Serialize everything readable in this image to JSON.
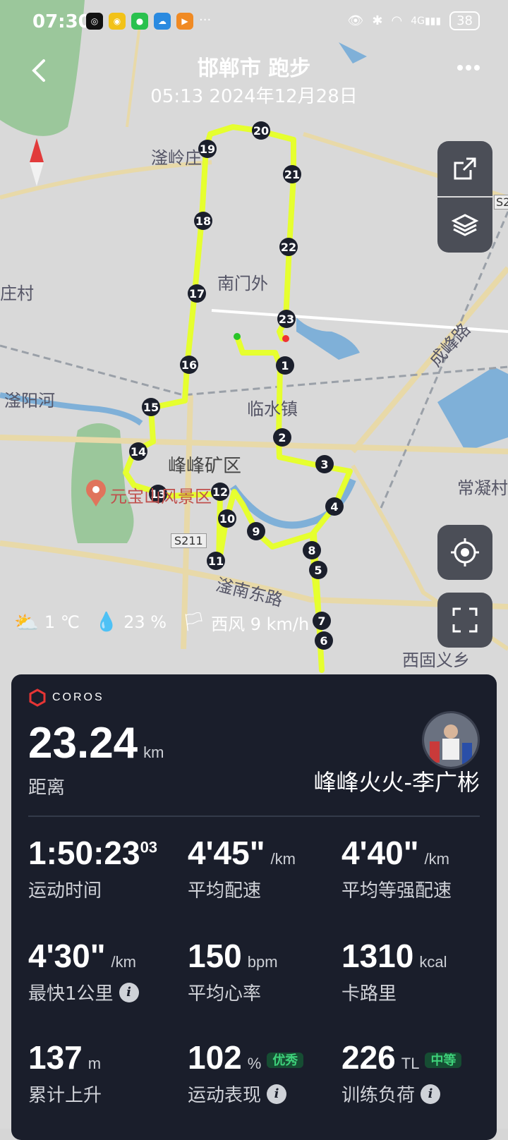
{
  "status_bar": {
    "time": "07:30",
    "network": "4G",
    "battery": "38",
    "apps": [
      "app-a",
      "app-b",
      "wechat",
      "app-c",
      "app-d"
    ],
    "more": "···"
  },
  "header": {
    "title": "邯郸市 跑步",
    "subtitle": "05:13 2024年12月28日"
  },
  "map": {
    "place_labels": [
      {
        "text": "滏岭庄"
      },
      {
        "text": "南门外"
      },
      {
        "text": "庄村"
      },
      {
        "text": "滏阳河"
      },
      {
        "text": "临水镇"
      },
      {
        "text": "峰峰矿区"
      },
      {
        "text": "成峰路"
      },
      {
        "text": "常凝村"
      },
      {
        "text": "元宝山风景区"
      },
      {
        "text": "S211"
      },
      {
        "text": "滏南东路"
      },
      {
        "text": "西固义乡"
      },
      {
        "text": "S2"
      }
    ],
    "km_markers": [
      "1",
      "2",
      "3",
      "4",
      "5",
      "6",
      "7",
      "8",
      "9",
      "10",
      "11",
      "12",
      "13",
      "14",
      "15",
      "16",
      "17",
      "18",
      "19",
      "20",
      "21",
      "22",
      "23"
    ]
  },
  "weather": {
    "temperature": "1 ℃",
    "humidity": "23  %",
    "wind": "西风 9 km/h"
  },
  "card": {
    "brand": "COROS",
    "distance_value": "23.24",
    "distance_unit": "km",
    "distance_label": "距离",
    "username": "峰峰火火-李广彬",
    "stats": [
      {
        "value": "1:50:23",
        "sup": "03",
        "unit": "",
        "label": "运动时间"
      },
      {
        "value": "4'45\"",
        "unit": "/km",
        "label": "平均配速"
      },
      {
        "value": "4'40\"",
        "unit": "/km",
        "label": "平均等强配速"
      },
      {
        "value": "4'30\"",
        "unit": "/km",
        "label": "最快1公里"
      },
      {
        "value": "150",
        "unit": "bpm",
        "label": "平均心率"
      },
      {
        "value": "1310",
        "unit": "kcal",
        "label": "卡路里"
      },
      {
        "value": "137",
        "unit": "m",
        "label": "累计上升"
      },
      {
        "value": "102",
        "unit": "%",
        "badge": "优秀",
        "label": "运动表现"
      },
      {
        "value": "226",
        "unit": "TL",
        "badge": "中等",
        "label": "训练负荷"
      }
    ]
  },
  "colors": {
    "route": "#e6ff2f",
    "card_bg": "#1a1e2b",
    "badge_green": "#3ed17a"
  }
}
